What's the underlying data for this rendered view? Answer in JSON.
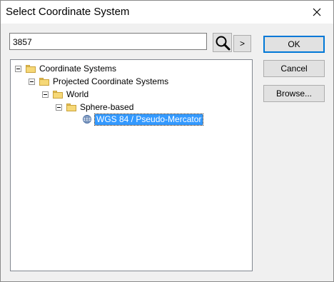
{
  "window": {
    "title": "Select Coordinate System",
    "close_icon": "close-icon"
  },
  "search": {
    "value": "3857",
    "search_icon": "magnifier-icon",
    "next_label": ">"
  },
  "tree": {
    "nodes": [
      {
        "label": "Coordinate Systems",
        "icon": "folder-icon",
        "expanded": true
      },
      {
        "label": "Projected Coordinate Systems",
        "icon": "folder-icon",
        "expanded": true
      },
      {
        "label": "World",
        "icon": "folder-icon",
        "expanded": true
      },
      {
        "label": "Sphere-based",
        "icon": "folder-icon",
        "expanded": true
      },
      {
        "label": "WGS 84 / Pseudo-Mercator",
        "icon": "globe-icon",
        "selected": true
      }
    ]
  },
  "buttons": {
    "ok": "OK",
    "cancel": "Cancel",
    "browse": "Browse..."
  },
  "colors": {
    "selection": "#3399ff",
    "default_button_border": "#0078d7"
  }
}
